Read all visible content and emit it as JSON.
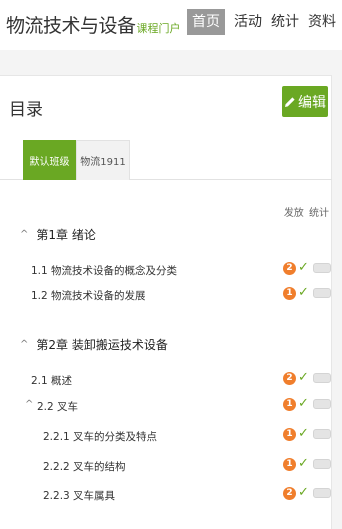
{
  "header": {
    "brand_title": "物流技术与设备",
    "brand_sub": "课程门户",
    "nav": [
      "首页",
      "活动",
      "统计",
      "资料"
    ]
  },
  "card": {
    "title": "目录",
    "edit_label": "编辑",
    "tabs": [
      "默认班级",
      "物流1911"
    ],
    "col_heads": [
      "发放",
      "统计"
    ]
  },
  "chapters": [
    {
      "caret": "^",
      "title": "第1章 绪论"
    },
    {
      "caret": "^",
      "title": "第2章 装卸搬运技术设备"
    }
  ],
  "rows": [
    {
      "label": "1.1 物流技术设备的概念及分类",
      "badge": "2"
    },
    {
      "label": "1.2 物流技术设备的发展",
      "badge": "1"
    },
    {
      "label": "2.1 概述",
      "badge": "2"
    },
    {
      "caret": "^",
      "label": "2.2 叉车",
      "badge": "1"
    },
    {
      "label": "2.2.1 叉车的分类及特点",
      "badge": "1"
    },
    {
      "label": "2.2.2 叉车的结构",
      "badge": "1"
    },
    {
      "label": "2.2.3 叉车属具",
      "badge": "2"
    }
  ],
  "icons": {
    "check": "✓",
    "edit": "pencil-icon"
  },
  "colors": {
    "accent": "#6aa823",
    "badge": "#f07e2c",
    "nav_active": "#999999"
  }
}
